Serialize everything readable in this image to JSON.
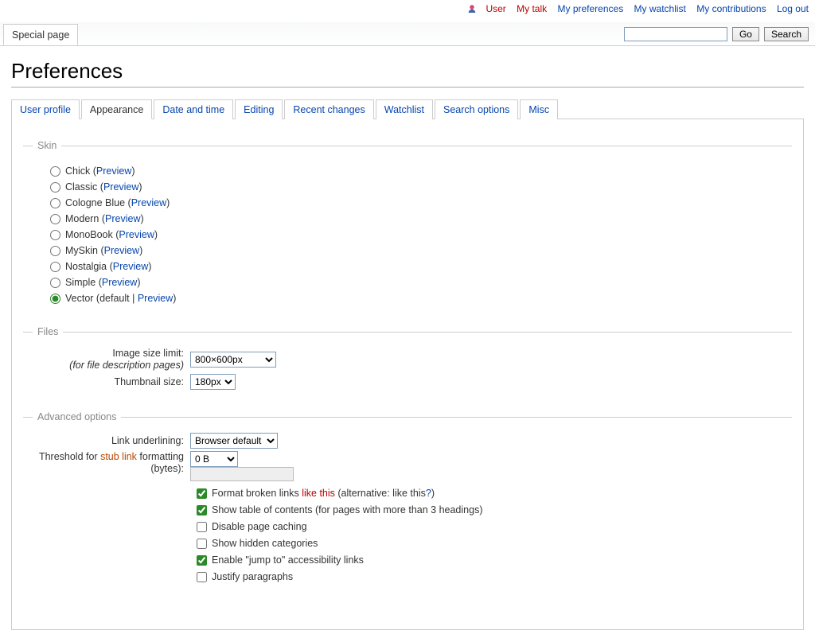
{
  "personal": {
    "user": "User",
    "mytalk": "My talk",
    "prefs": "My preferences",
    "watchlist": "My watchlist",
    "contribs": "My contributions",
    "logout": "Log out"
  },
  "topTab": "Special page",
  "search": {
    "go": "Go",
    "search": "Search"
  },
  "pageTitle": "Preferences",
  "tabs": {
    "userprofile": "User profile",
    "appearance": "Appearance",
    "datetime": "Date and time",
    "editing": "Editing",
    "recentchanges": "Recent changes",
    "watchlist": "Watchlist",
    "searchoptions": "Search options",
    "misc": "Misc"
  },
  "sections": {
    "skin": "Skin",
    "files": "Files",
    "advanced": "Advanced options"
  },
  "skins": {
    "chick": "Chick",
    "classic": "Classic",
    "cologne": "Cologne Blue",
    "modern": "Modern",
    "monobook": "MonoBook",
    "myskin": "MySkin",
    "nostalgia": "Nostalgia",
    "simple": "Simple",
    "vector": "Vector",
    "default": "default",
    "preview": "Preview"
  },
  "files": {
    "imageLimitLabel": "Image size limit:",
    "imageLimitSub": "(for file description pages)",
    "imageLimitValue": "800×600px",
    "thumbLabel": "Thumbnail size:",
    "thumbValue": "180px"
  },
  "adv": {
    "underlineLabel": "Link underlining:",
    "underlineValue": "Browser default",
    "stubLabelA": "Threshold for ",
    "stubLabelLink": "stub link",
    "stubLabelB": " formatting (bytes):",
    "stubValue": "0 B",
    "c1a": "Format broken links ",
    "c1b": "like this",
    "c1c": " (alternative: like this",
    "c1d": "?",
    "c1e": ")",
    "c2": "Show table of contents (for pages with more than 3 headings)",
    "c3": "Disable page caching",
    "c4": "Show hidden categories",
    "c5": "Enable \"jump to\" accessibility links",
    "c6": "Justify paragraphs"
  }
}
